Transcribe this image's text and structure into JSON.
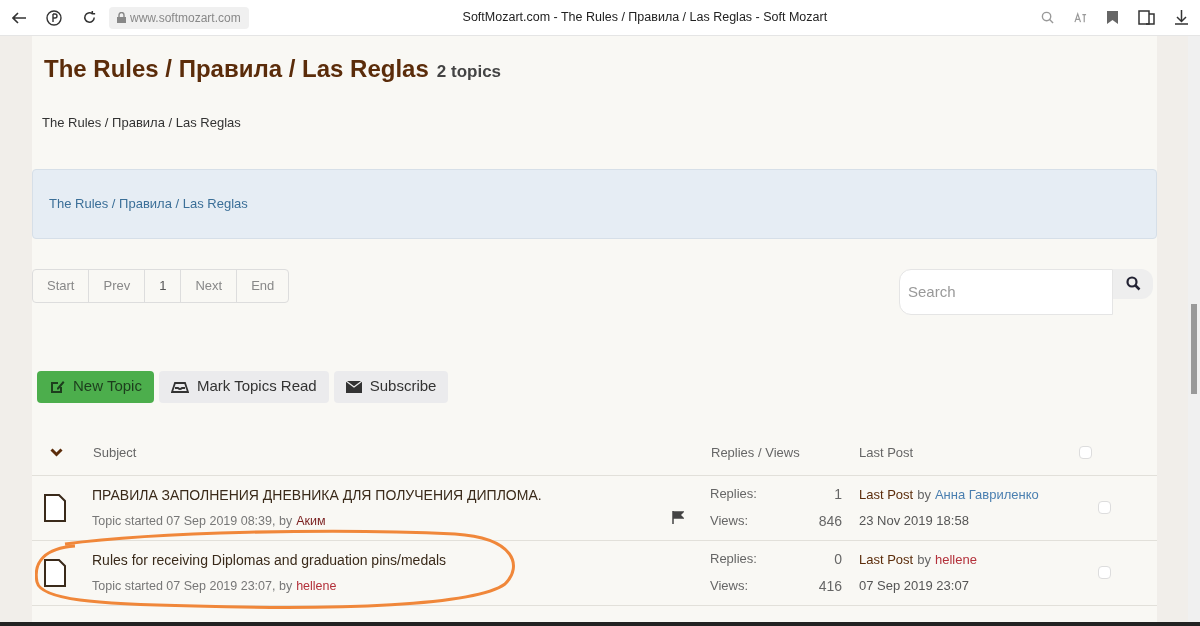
{
  "browser": {
    "url": "www.softmozart.com",
    "title": "SoftMozart.com - The Rules / Правила / Las Reglas - Soft Mozart"
  },
  "forum": {
    "title": "The Rules / Правила / Las Reglas",
    "count": "2 topics",
    "description": "The Rules / Правила / Las Reglas",
    "breadcrumb": "The Rules / Правила / Las Reglas"
  },
  "pagination": [
    {
      "label": "Start",
      "selected": false
    },
    {
      "label": "Prev",
      "selected": false
    },
    {
      "label": "1",
      "selected": true
    },
    {
      "label": "Next",
      "selected": false
    },
    {
      "label": "End",
      "selected": false
    }
  ],
  "search": {
    "placeholder": "Search"
  },
  "actions": [
    {
      "kind": "new",
      "label": "New Topic"
    },
    {
      "kind": "read",
      "label": "Mark Topics Read"
    },
    {
      "kind": "subscribe",
      "label": "Subscribe"
    }
  ],
  "table": {
    "columns": [
      "Subject",
      "Replies / Views",
      "Last Post"
    ],
    "all_checked": false,
    "rows": [
      {
        "title": "ПРАВИЛА ЗАПОЛНЕНИЯ ДНЕВНИКА ДЛЯ ПОЛУЧЕНИЯ ДИПЛОМА.",
        "started": "Topic started 07 Sep 2019 08:39, by",
        "author": {
          "name": "Аким",
          "color": "#7a1f1f"
        },
        "flagged": true,
        "replies_label": "Replies:",
        "replies": "1",
        "views_label": "Views:",
        "views": "846",
        "last_label": "Last Post",
        "last_by": "by",
        "last_user": {
          "name": "Анна Гавриленко",
          "color": "#4a7fb0"
        },
        "last_date": "23 Nov 2019 18:58",
        "highlighted": false,
        "checked": false
      },
      {
        "title": "Rules for receiving Diplomas and graduation pins/medals",
        "started": "Topic started 07 Sep 2019 23:07, by",
        "author": {
          "name": "hellene",
          "color": "#b3303a"
        },
        "flagged": false,
        "replies_label": "Replies:",
        "replies": "0",
        "views_label": "Views:",
        "views": "416",
        "last_label": "Last Post",
        "last_by": "by",
        "last_user": {
          "name": "hellene",
          "color": "#b3303a"
        },
        "last_date": "07 Sep 2019 23:07",
        "highlighted": true,
        "checked": false
      }
    ]
  }
}
